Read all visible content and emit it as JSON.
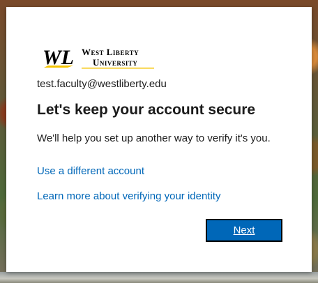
{
  "logo": {
    "initials": "WL",
    "line1": "West Liberty",
    "line2": "University",
    "brand_colors": {
      "black": "#000000",
      "gold": "#f5c400"
    }
  },
  "account": {
    "email": "test.faculty@westliberty.edu"
  },
  "main": {
    "title": "Let's keep your account secure",
    "description": "We'll help you set up another way to verify it's you."
  },
  "links": {
    "different_account": "Use a different account",
    "learn_more": "Learn more about verifying your identity"
  },
  "actions": {
    "next_label": "Next"
  },
  "colors": {
    "accent": "#0067b8",
    "text": "#1b1b1b"
  }
}
